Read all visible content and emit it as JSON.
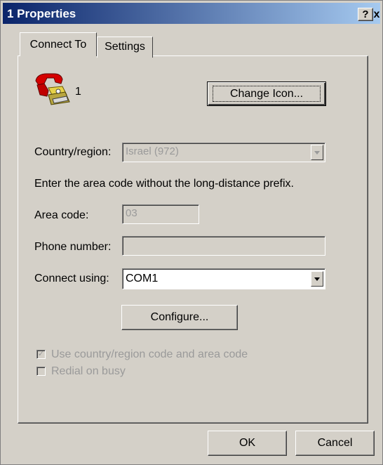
{
  "window": {
    "title": "1 Properties"
  },
  "titlebar": {
    "help_label": "?",
    "close_label": "x"
  },
  "tabs": [
    {
      "label": "Connect To"
    },
    {
      "label": "Settings"
    }
  ],
  "connection": {
    "name": "1"
  },
  "buttons": {
    "change_icon": "Change Icon...",
    "configure": "Configure...",
    "ok": "OK",
    "cancel": "Cancel"
  },
  "fields": {
    "country_label": "Country/region:",
    "country_value": "Israel (972)",
    "instruction": "Enter the area code without the long-distance prefix.",
    "area_code_label": "Area code:",
    "area_code_value": "03",
    "phone_label": "Phone number:",
    "phone_value": "",
    "connect_using_label": "Connect using:",
    "connect_using_value": "COM1"
  },
  "checkboxes": [
    {
      "label": "Use country/region code and area code",
      "checked": true,
      "enabled": false
    },
    {
      "label": "Redial on busy",
      "checked": false,
      "enabled": false
    }
  ]
}
